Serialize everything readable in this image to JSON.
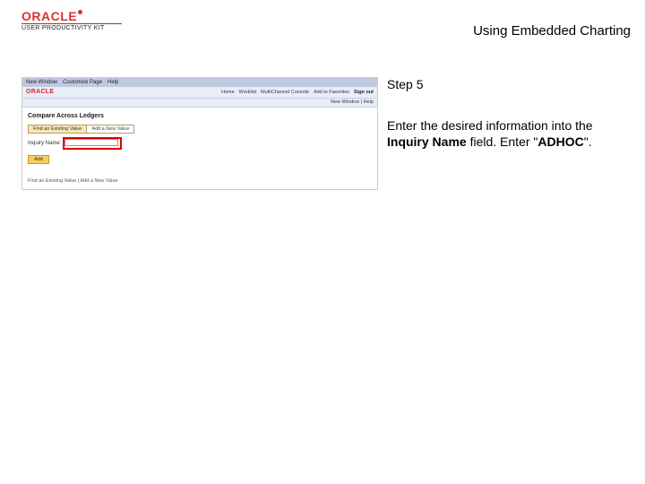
{
  "header": {
    "logo_text": "ORACLE",
    "logo_subtext": "USER PRODUCTIVITY KIT",
    "page_title": "Using Embedded Charting"
  },
  "right_panel": {
    "step_label": "Step 5",
    "instr_pre": "Enter the desired information into the ",
    "instr_field": "Inquiry Name",
    "instr_mid": " field. Enter \"",
    "instr_value": "ADHOC",
    "instr_post": "\"."
  },
  "screenshot": {
    "topnav": [
      "New Window",
      "Customize Page",
      "Help"
    ],
    "brand": "ORACLE",
    "nav_right": [
      "Home",
      "Worklist",
      "MultiChannel Console",
      "Add to Favorites",
      "Sign out"
    ],
    "service_row": "New Window | Help",
    "heading": "Compare Across Ledgers",
    "tabs": {
      "active": "Find an Existing Value",
      "other": "Add a New Value"
    },
    "field_label": "Inquiry Name:",
    "add_button": "Add",
    "footer": "Find an Existing Value | Add a New Value"
  }
}
